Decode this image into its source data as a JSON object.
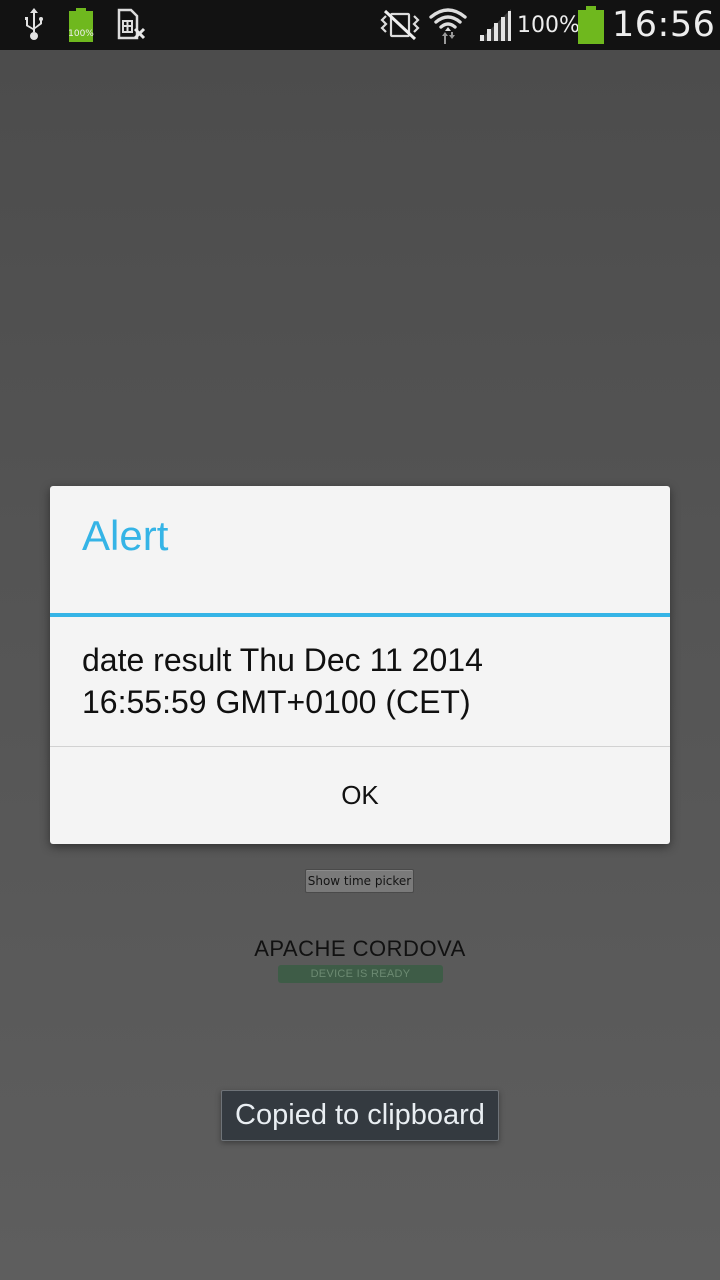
{
  "status_bar": {
    "icons": [
      "usb-icon",
      "battery-saver-icon",
      "no-sim-icon",
      "vibrate-mute-icon",
      "wifi-icon",
      "signal-icon",
      "battery-icon"
    ],
    "mini_battery_label": "100%",
    "battery_percent": "100%",
    "time": "16:56",
    "colors": {
      "battery_green": "#6fb81e"
    }
  },
  "app": {
    "time_picker_button": "Show time picker",
    "cordova_title": "APACHE CORDOVA",
    "device_status": "DEVICE IS READY"
  },
  "dialog": {
    "title": "Alert",
    "message_line1": "date result Thu Dec 11 2014",
    "message_line2": "16:55:59 GMT+0100 (CET)",
    "ok_label": "OK",
    "accent_color": "#35b4e6"
  },
  "toast": {
    "text": "Copied to clipboard"
  }
}
